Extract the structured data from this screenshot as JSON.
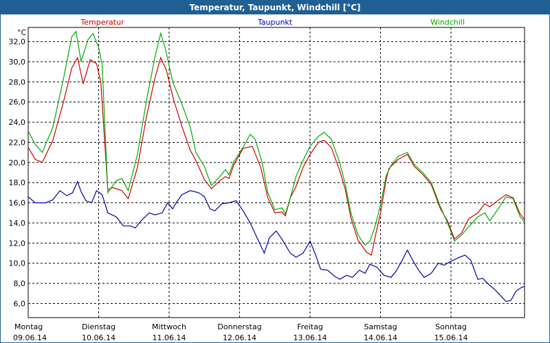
{
  "window": {
    "title": "Temperatur, Taupunkt, Windchill [°C]"
  },
  "chart_data": {
    "type": "line",
    "title": "Temperatur, Taupunkt, Windchill [°C]",
    "ylabel": "°C",
    "ylim": [
      4.6,
      33.4
    ],
    "xlim": [
      0,
      7
    ],
    "grid": true,
    "legend": "top",
    "y_ticks": [
      6,
      8,
      10,
      12,
      14,
      16,
      18,
      20,
      22,
      24,
      26,
      28,
      30,
      32
    ],
    "y_tick_labels": [
      "6,0",
      "8,0",
      "10,0",
      "12,0",
      "14,0",
      "16,0",
      "18,0",
      "20,0",
      "22,0",
      "24,0",
      "26,0",
      "28,0",
      "30,0",
      "32,0"
    ],
    "x_ticks": [
      {
        "pos": 0,
        "day": "Montag",
        "date": "09.06.14"
      },
      {
        "pos": 1,
        "day": "Dienstag",
        "date": "10.06.14"
      },
      {
        "pos": 2,
        "day": "Mittwoch",
        "date": "11.06.14"
      },
      {
        "pos": 3,
        "day": "Donnerstag",
        "date": "12.06.14"
      },
      {
        "pos": 4,
        "day": "Freitag",
        "date": "13.06.14"
      },
      {
        "pos": 5,
        "day": "Samstag",
        "date": "14.06.14"
      },
      {
        "pos": 6,
        "day": "Sonntag",
        "date": "15.06.14"
      }
    ],
    "series": [
      {
        "name": "Temperatur",
        "color": "#cc0000",
        "points": [
          [
            0,
            21.5
          ],
          [
            0.1,
            20.3
          ],
          [
            0.2,
            20.0
          ],
          [
            0.35,
            22.2
          ],
          [
            0.5,
            26.0
          ],
          [
            0.62,
            29.4
          ],
          [
            0.7,
            30.4
          ],
          [
            0.78,
            27.8
          ],
          [
            0.88,
            30.2
          ],
          [
            0.97,
            29.8
          ],
          [
            1.03,
            28.0
          ],
          [
            1.13,
            17.3
          ],
          [
            1.2,
            17.5
          ],
          [
            1.33,
            17.2
          ],
          [
            1.42,
            16.4
          ],
          [
            1.55,
            19.5
          ],
          [
            1.68,
            24.6
          ],
          [
            1.8,
            28.4
          ],
          [
            1.88,
            30.4
          ],
          [
            1.96,
            29.2
          ],
          [
            2.06,
            26.3
          ],
          [
            2.18,
            23.6
          ],
          [
            2.3,
            21.2
          ],
          [
            2.38,
            20.2
          ],
          [
            2.5,
            18.3
          ],
          [
            2.6,
            17.4
          ],
          [
            2.72,
            18.2
          ],
          [
            2.8,
            18.6
          ],
          [
            2.85,
            18.4
          ],
          [
            2.92,
            19.8
          ],
          [
            3.05,
            21.4
          ],
          [
            3.18,
            21.6
          ],
          [
            3.3,
            19.5
          ],
          [
            3.4,
            16.5
          ],
          [
            3.5,
            15.0
          ],
          [
            3.6,
            15.1
          ],
          [
            3.65,
            14.7
          ],
          [
            3.72,
            16.5
          ],
          [
            3.8,
            17.6
          ],
          [
            3.9,
            19.5
          ],
          [
            4.0,
            20.8
          ],
          [
            4.12,
            22.0
          ],
          [
            4.2,
            22.2
          ],
          [
            4.3,
            21.5
          ],
          [
            4.42,
            19.2
          ],
          [
            4.5,
            17.3
          ],
          [
            4.58,
            14.5
          ],
          [
            4.68,
            12.3
          ],
          [
            4.8,
            11.1
          ],
          [
            4.87,
            10.8
          ],
          [
            4.92,
            12.5
          ],
          [
            5.0,
            15.0
          ],
          [
            5.08,
            18.3
          ],
          [
            5.12,
            19.4
          ],
          [
            5.25,
            20.3
          ],
          [
            5.38,
            20.8
          ],
          [
            5.48,
            19.6
          ],
          [
            5.6,
            18.8
          ],
          [
            5.72,
            17.8
          ],
          [
            5.85,
            15.4
          ],
          [
            5.95,
            14.2
          ],
          [
            6.05,
            12.4
          ],
          [
            6.15,
            13.0
          ],
          [
            6.25,
            14.4
          ],
          [
            6.38,
            15.0
          ],
          [
            6.48,
            15.9
          ],
          [
            6.55,
            15.6
          ],
          [
            6.68,
            16.3
          ],
          [
            6.78,
            16.8
          ],
          [
            6.88,
            16.5
          ],
          [
            6.98,
            14.9
          ],
          [
            7.1,
            13.8
          ],
          [
            7.2,
            12.1
          ],
          [
            7.3,
            12.6
          ],
          [
            7.38,
            14.1
          ],
          [
            7.48,
            14.6
          ],
          [
            7.55,
            16.7
          ],
          [
            7.63,
            18.2
          ],
          [
            7.75,
            19.0
          ],
          [
            7.85,
            19.1
          ],
          [
            7.95,
            18.9
          ],
          [
            8.05,
            17.9
          ],
          [
            8.15,
            14.8
          ],
          [
            8.2,
            13.6
          ]
        ]
      },
      {
        "name": "Taupunkt",
        "color": "#0000aa",
        "points": [
          [
            0,
            16.6
          ],
          [
            0.1,
            16.0
          ],
          [
            0.25,
            16.0
          ],
          [
            0.35,
            16.3
          ],
          [
            0.45,
            17.2
          ],
          [
            0.55,
            16.7
          ],
          [
            0.63,
            17.0
          ],
          [
            0.7,
            18.1
          ],
          [
            0.75,
            17.1
          ],
          [
            0.82,
            16.2
          ],
          [
            0.9,
            16.0
          ],
          [
            0.97,
            17.2
          ],
          [
            1.05,
            16.8
          ],
          [
            1.13,
            15.0
          ],
          [
            1.25,
            14.6
          ],
          [
            1.35,
            13.7
          ],
          [
            1.45,
            13.7
          ],
          [
            1.52,
            13.5
          ],
          [
            1.6,
            14.2
          ],
          [
            1.72,
            15.0
          ],
          [
            1.8,
            14.8
          ],
          [
            1.9,
            15.0
          ],
          [
            1.98,
            16.0
          ],
          [
            2.05,
            15.4
          ],
          [
            2.1,
            16.0
          ],
          [
            2.18,
            16.8
          ],
          [
            2.3,
            17.2
          ],
          [
            2.42,
            17.0
          ],
          [
            2.5,
            16.6
          ],
          [
            2.58,
            15.4
          ],
          [
            2.65,
            15.2
          ],
          [
            2.75,
            15.9
          ],
          [
            2.85,
            16.0
          ],
          [
            2.95,
            16.2
          ],
          [
            3.05,
            15.2
          ],
          [
            3.15,
            14.0
          ],
          [
            3.25,
            12.5
          ],
          [
            3.35,
            11.0
          ],
          [
            3.42,
            12.5
          ],
          [
            3.52,
            13.2
          ],
          [
            3.6,
            12.4
          ],
          [
            3.72,
            11.0
          ],
          [
            3.8,
            10.6
          ],
          [
            3.9,
            11.0
          ],
          [
            4.0,
            12.2
          ],
          [
            4.08,
            10.8
          ],
          [
            4.15,
            9.4
          ],
          [
            4.25,
            9.3
          ],
          [
            4.35,
            8.7
          ],
          [
            4.42,
            8.4
          ],
          [
            4.52,
            8.8
          ],
          [
            4.6,
            8.6
          ],
          [
            4.7,
            9.3
          ],
          [
            4.78,
            9.0
          ],
          [
            4.85,
            9.9
          ],
          [
            4.95,
            9.6
          ],
          [
            5.05,
            8.8
          ],
          [
            5.15,
            8.6
          ],
          [
            5.22,
            9.2
          ],
          [
            5.3,
            10.2
          ],
          [
            5.38,
            11.3
          ],
          [
            5.48,
            10.0
          ],
          [
            5.55,
            9.2
          ],
          [
            5.62,
            8.6
          ],
          [
            5.72,
            9.0
          ],
          [
            5.82,
            10.0
          ],
          [
            5.9,
            9.8
          ],
          [
            6.0,
            10.2
          ],
          [
            6.12,
            10.6
          ],
          [
            6.2,
            10.8
          ],
          [
            6.28,
            10.3
          ],
          [
            6.38,
            8.4
          ],
          [
            6.45,
            8.5
          ],
          [
            6.55,
            7.8
          ],
          [
            6.62,
            7.4
          ],
          [
            6.7,
            6.8
          ],
          [
            6.78,
            6.2
          ],
          [
            6.85,
            6.3
          ],
          [
            6.92,
            7.2
          ],
          [
            7.0,
            7.6
          ],
          [
            7.1,
            7.8
          ],
          [
            7.2,
            8.2
          ],
          [
            7.3,
            8.8
          ],
          [
            7.38,
            9.4
          ],
          [
            7.48,
            10.2
          ],
          [
            7.55,
            9.5
          ],
          [
            7.65,
            9.7
          ],
          [
            7.72,
            9.6
          ],
          [
            7.82,
            9.7
          ],
          [
            7.92,
            9.5
          ],
          [
            8.0,
            9.2
          ],
          [
            8.1,
            8.0
          ],
          [
            8.18,
            6.0
          ],
          [
            8.25,
            6.1
          ],
          [
            8.32,
            7.0
          ],
          [
            8.42,
            8.0
          ],
          [
            8.5,
            9.0
          ],
          [
            8.58,
            9.5
          ],
          [
            8.65,
            9.2
          ]
        ]
      },
      {
        "name": "Windchill",
        "color": "#00aa00",
        "points": [
          [
            0,
            23.1
          ],
          [
            0.1,
            21.8
          ],
          [
            0.2,
            21.0
          ],
          [
            0.35,
            23.5
          ],
          [
            0.5,
            28.3
          ],
          [
            0.62,
            32.5
          ],
          [
            0.68,
            33.0
          ],
          [
            0.75,
            30.0
          ],
          [
            0.85,
            32.2
          ],
          [
            0.92,
            32.8
          ],
          [
            1.0,
            31.4
          ],
          [
            1.05,
            29.7
          ],
          [
            1.13,
            17.0
          ],
          [
            1.25,
            18.2
          ],
          [
            1.33,
            18.4
          ],
          [
            1.42,
            17.2
          ],
          [
            1.55,
            20.8
          ],
          [
            1.68,
            26.2
          ],
          [
            1.8,
            30.5
          ],
          [
            1.88,
            32.8
          ],
          [
            1.95,
            31.2
          ],
          [
            2.05,
            28.0
          ],
          [
            2.18,
            25.8
          ],
          [
            2.3,
            23.5
          ],
          [
            2.38,
            21.0
          ],
          [
            2.5,
            19.6
          ],
          [
            2.6,
            17.7
          ],
          [
            2.72,
            18.6
          ],
          [
            2.8,
            19.3
          ],
          [
            2.85,
            18.8
          ],
          [
            2.92,
            20.1
          ],
          [
            3.05,
            21.5
          ],
          [
            3.15,
            22.8
          ],
          [
            3.22,
            22.3
          ],
          [
            3.32,
            20.0
          ],
          [
            3.4,
            17.0
          ],
          [
            3.5,
            15.3
          ],
          [
            3.6,
            15.5
          ],
          [
            3.65,
            14.9
          ],
          [
            3.72,
            16.5
          ],
          [
            3.8,
            18.6
          ],
          [
            3.9,
            20.2
          ],
          [
            4.0,
            21.6
          ],
          [
            4.12,
            22.6
          ],
          [
            4.2,
            23.0
          ],
          [
            4.3,
            22.3
          ],
          [
            4.42,
            20.0
          ],
          [
            4.5,
            17.8
          ],
          [
            4.58,
            15.0
          ],
          [
            4.68,
            12.8
          ],
          [
            4.78,
            11.8
          ],
          [
            4.85,
            12.2
          ],
          [
            4.92,
            13.6
          ],
          [
            5.0,
            15.8
          ],
          [
            5.08,
            18.7
          ],
          [
            5.15,
            19.7
          ],
          [
            5.25,
            20.6
          ],
          [
            5.38,
            21.0
          ],
          [
            5.48,
            19.8
          ],
          [
            5.6,
            19.0
          ],
          [
            5.72,
            18.0
          ],
          [
            5.85,
            15.6
          ],
          [
            5.95,
            14.0
          ],
          [
            6.05,
            12.2
          ],
          [
            6.15,
            12.8
          ],
          [
            6.25,
            13.6
          ],
          [
            6.38,
            14.6
          ],
          [
            6.48,
            15.0
          ],
          [
            6.55,
            14.2
          ],
          [
            6.68,
            15.5
          ],
          [
            6.78,
            16.6
          ],
          [
            6.88,
            16.4
          ],
          [
            6.98,
            14.6
          ],
          [
            7.08,
            13.8
          ],
          [
            7.18,
            12.4
          ],
          [
            7.28,
            12.8
          ],
          [
            7.36,
            11.5
          ],
          [
            7.46,
            14.6
          ],
          [
            7.55,
            17.2
          ],
          [
            7.65,
            18.6
          ],
          [
            7.78,
            19.5
          ],
          [
            7.88,
            19.4
          ],
          [
            8.0,
            18.8
          ],
          [
            8.1,
            16.4
          ],
          [
            8.2,
            14.0
          ]
        ]
      }
    ]
  }
}
